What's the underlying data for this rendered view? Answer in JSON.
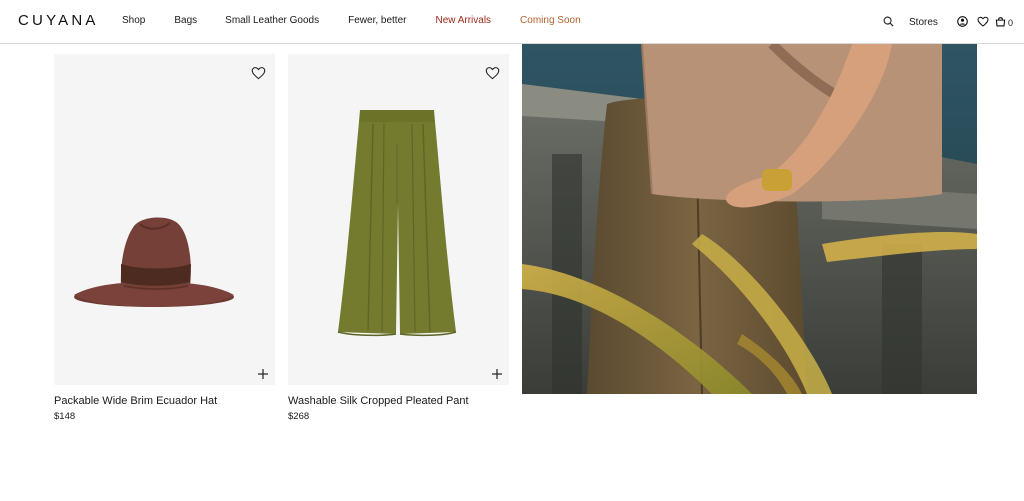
{
  "brand": {
    "logo": "CUYANA"
  },
  "nav": {
    "items": [
      {
        "label": "Shop"
      },
      {
        "label": "Bags"
      },
      {
        "label": "Small Leather Goods"
      },
      {
        "label": "Fewer, better"
      },
      {
        "label": "New Arrivals"
      },
      {
        "label": "Coming Soon"
      }
    ],
    "accent_colors": {
      "new_arrivals": "#9a2a17",
      "coming_soon": "#b4622d"
    }
  },
  "utility": {
    "stores_label": "Stores",
    "bag_count": "0",
    "icons": [
      "search-icon",
      "account-icon",
      "heart-icon",
      "bag-icon"
    ]
  },
  "products": [
    {
      "name": "Packable Wide Brim Ecuador Hat",
      "price": "$148",
      "image": "hat-image"
    },
    {
      "name": "Washable Silk Cropped Pleated Pant",
      "price": "$268",
      "image": "pant-image"
    }
  ],
  "hero": {
    "image": "lifestyle-tote-bag-image"
  }
}
